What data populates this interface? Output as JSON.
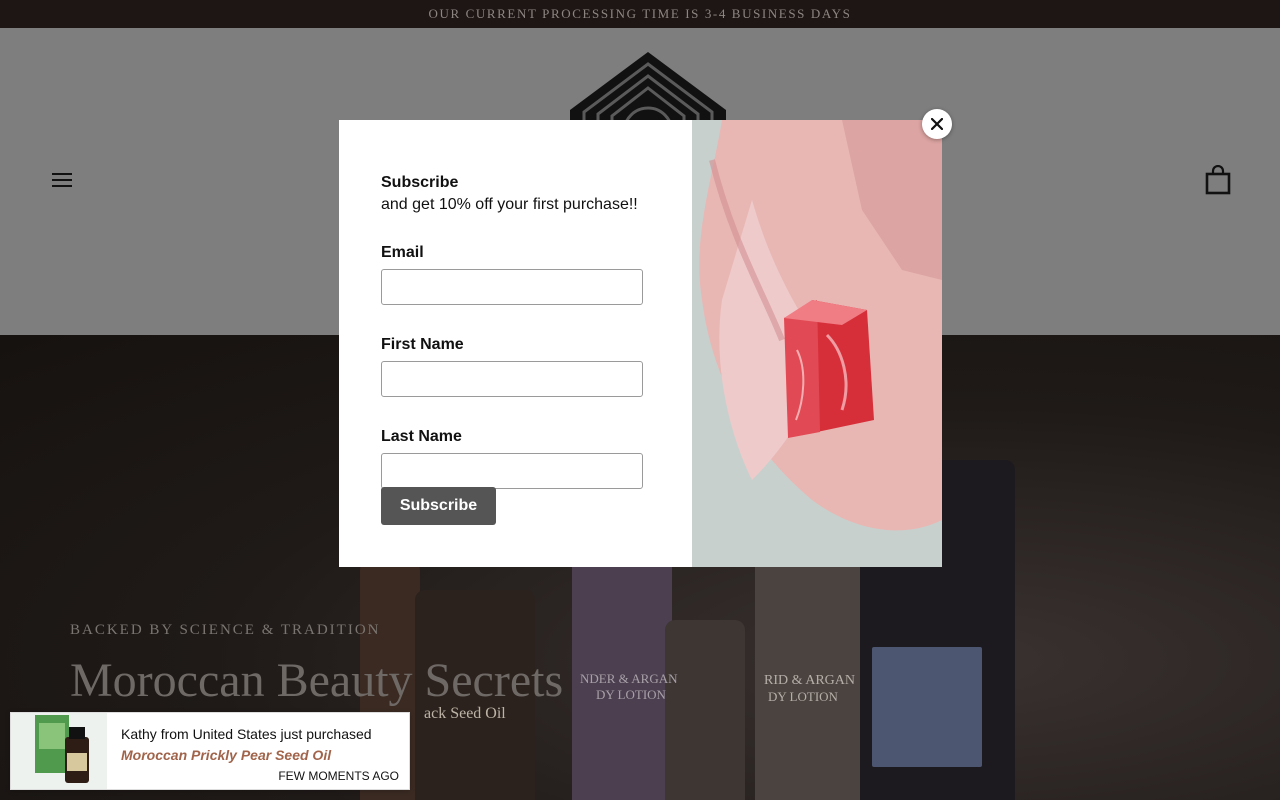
{
  "announcement": "OUR CURRENT PROCESSING TIME IS 3-4 BUSINESS DAYS",
  "header": {
    "menu_icon": "hamburger-icon",
    "cart_icon": "shopping-bag-icon"
  },
  "hero": {
    "kicker": "BACKED BY SCIENCE & TRADITION",
    "title": "Moroccan Beauty Secrets",
    "bottle_labels": [
      "ack Seed Oil",
      "NDER & ARGAN",
      "DY LOTION",
      "RID & ARGAN",
      "DY LOTION"
    ]
  },
  "popup": {
    "heading": "Subscribe",
    "subheading": "and get 10% off your first purchase!!",
    "email_label": "Email",
    "first_name_label": "First Name",
    "last_name_label": "Last Name",
    "email_value": "",
    "first_name_value": "",
    "last_name_value": "",
    "submit_label": "Subscribe",
    "close_icon": "close-icon"
  },
  "toast": {
    "line1": "Kathy from United States just purchased",
    "product": "Moroccan Prickly Pear Seed Oil",
    "time": "FEW MOMENTS AGO"
  }
}
